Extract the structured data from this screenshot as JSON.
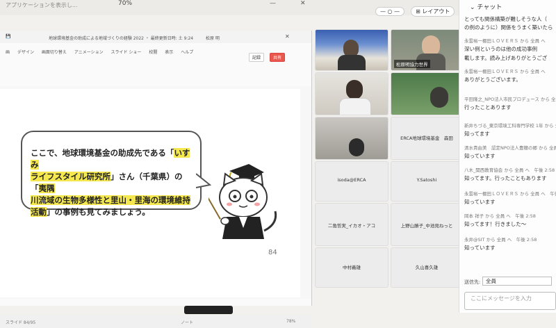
{
  "top": {
    "blurred_text": "アプリケーションを表示し...",
    "zoom": "70%"
  },
  "view_controls": {
    "layout_label": "レイアウト"
  },
  "ppt": {
    "title": "地球環境基金の助成による地域づくりの経験 2022 ・ 最終更新日時: 土 9:24",
    "user": "松原 明",
    "menu": [
      "画",
      "デザイン",
      "画面切り替え",
      "アニメーション",
      "スライド ショー",
      "校閲",
      "表示",
      "ヘルプ"
    ],
    "record_label": "記録",
    "share_label": "共有",
    "page_number": "84",
    "status_left": "スライド 84/95",
    "status_right": "ノート",
    "zoom": "78%"
  },
  "slide": {
    "line1_a": "ここで、地球環境基金の助成先である「",
    "line1_hl": "いすみ",
    "line2_hl": "ライフスタイル研究所",
    "line2_b": "」さん（千葉県）の「",
    "line2_hl2": "夷隅",
    "line3_hl": "川流域の生物多様性と里山・里海の環境維持",
    "line4_hl": "活動",
    "line4_b": "」の事例も見てみましょう。"
  },
  "video": {
    "tiles": [
      {
        "name": "participant-1",
        "label": ""
      },
      {
        "name": "participant-matsubara",
        "label": "松原明協力世界"
      },
      {
        "name": "participant-3",
        "label": ""
      },
      {
        "name": "participant-4",
        "label": ""
      },
      {
        "name": "participant-5",
        "label": ""
      },
      {
        "name": "participant-erca",
        "label": "ERCA地球環境基金　森田"
      },
      {
        "name": "participant-isoda",
        "label": "isoda@ERCA"
      },
      {
        "name": "participant-ysatoshi",
        "label": "Y.Satoshi"
      },
      {
        "name": "participant-nikado",
        "label": "二角哲実_イカオ・アコ"
      },
      {
        "name": "participant-ueno",
        "label": "上野山勝子_中池見ねっと"
      },
      {
        "name": "participant-nakamura",
        "label": "中村義雄"
      },
      {
        "name": "participant-kuyama",
        "label": "久山喜久雄"
      }
    ]
  },
  "chat": {
    "title": "チャット",
    "messages": [
      {
        "from": "",
        "text": "とっても関係構築が難しそうな人（"
      },
      {
        "from": "",
        "text": "の例のように）関係をうまく築いたら"
      },
      {
        "from": "永雲裕一棚田ＬＯＶＥＲＳ から 全員 へ",
        "text": "深い例というのは他の成功事例"
      },
      {
        "from": "",
        "text": "載します。読み上げありがとうござ"
      },
      {
        "from": "永雲裕一棚田ＬＯＶＥＲＳ から 全員 へ",
        "text": "ありがとうございます。"
      },
      {
        "from": "平田隆之_NPO法人市民プロデュース から 全員",
        "text": "行ったことあります"
      },
      {
        "from": "新井ちづる_東京環境工科専門学校 1年 から 全",
        "text": "知ってます"
      },
      {
        "from": "清水貴由美　認定NPO法人豊穣の郷 から 全員",
        "text": "知っています"
      },
      {
        "from": "八木_関西教育協会 から 全員 へ　午後 2:58",
        "text": "知ってます。行ったこともあります"
      },
      {
        "from": "永雲裕一棚田ＬＯＶＥＲＳ から 全員 へ　午後",
        "text": "知っています"
      },
      {
        "from": "岡本 祥子 から 全員 へ　午後 2:58",
        "text": "知ってます！行きました〜"
      },
      {
        "from": "永井@SIT から 全員 へ　午後 2:58",
        "text": "知っています"
      }
    ],
    "to_label": "送信先:",
    "to_value": "全員",
    "input_placeholder": "ここにメッセージを入力"
  }
}
